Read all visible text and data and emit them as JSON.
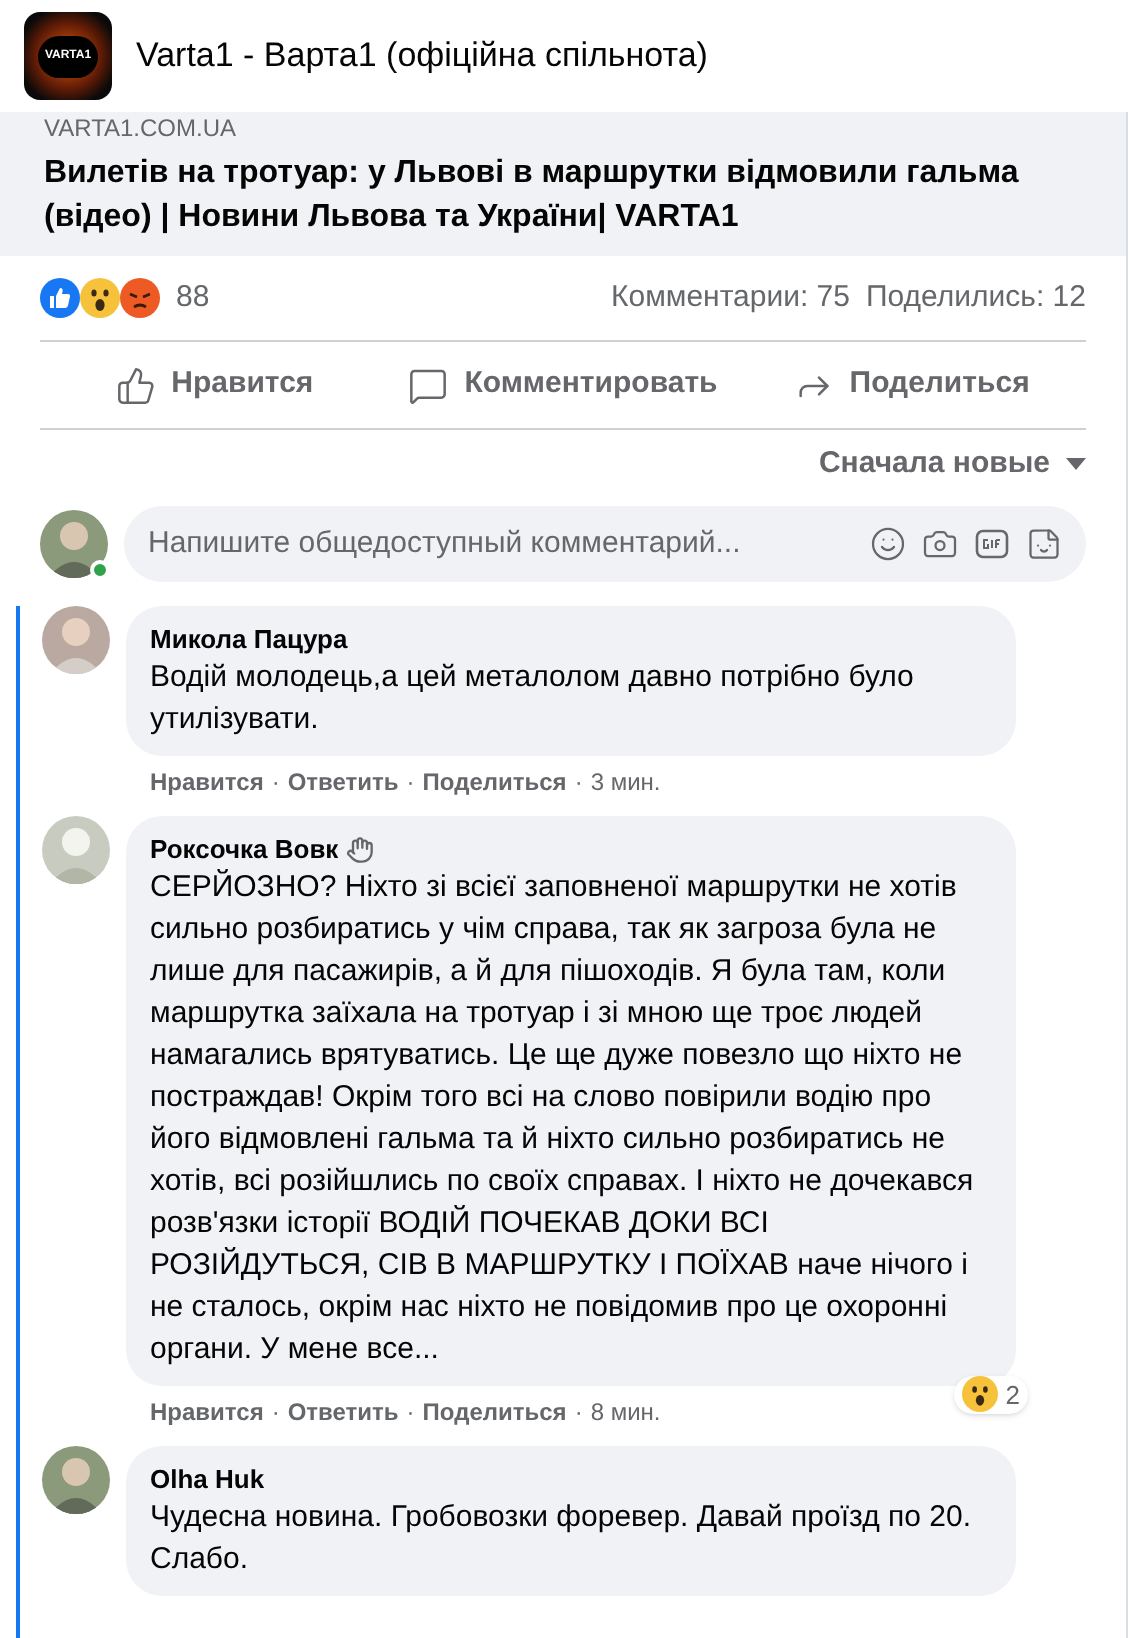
{
  "header": {
    "logo_text": "VARTA1",
    "title": "Varta1 - Варта1 (офіційна спільнота)"
  },
  "link_preview": {
    "domain": "VARTA1.COM.UA",
    "title": "Вилетів на тротуар: у Львові в маршрутки відмовили гальма (відео) | Новини Львова та України| VARTA1"
  },
  "stats": {
    "reactions_count": "88",
    "comments": "Комментарии: 75",
    "shares": "Поделились: 12"
  },
  "actions": [
    {
      "kind": "like",
      "label": "Нравится"
    },
    {
      "kind": "comment",
      "label": "Комментировать"
    },
    {
      "kind": "share",
      "label": "Поделиться"
    }
  ],
  "sort": {
    "label": "Сначала новые"
  },
  "composer": {
    "placeholder": "Напишите общедоступный комментарий...",
    "online": true
  },
  "comments": [
    {
      "author": "Микола Пацура",
      "wave": false,
      "text": "Водій молодець,а цей металолом давно потрібно було утилізувати.",
      "like": "Нравится",
      "reply": "Ответить",
      "share": "Поделиться",
      "separator": "·",
      "time": "3 мин."
    },
    {
      "author": "Роксочка Вовк",
      "wave": true,
      "text": "СЕРЙОЗНО? Ніхто зі всієї заповненої маршрутки не хотів сильно розбиратись у чім справа, так як загроза була не лише для пасажирів, а й для пішоходів. Я була там, коли маршрутка заїхала на тротуар і зі мною ще троє людей намагались врятуватись. Це ще дуже повезло що ніхто не постраждав! Окрім того всі на слово повірили водію про його відмовлені гальма та й ніхто сильно розбиратись не хотів, всі розійшлись по своїх справах. І ніхто не дочекався розв'язки історії ВОДІЙ ПОЧЕКАВ ДОКИ ВСІ РОЗІЙДУТЬСЯ, СІВ В МАРШРУТКУ І ПОЇХАВ наче нічого і не сталось, окрім нас ніхто не повідомив про це охоронні органи. У мене все...",
      "like": "Нравится",
      "reply": "Ответить",
      "share": "Поделиться",
      "separator": "·",
      "time": "8 мин.",
      "reaction_count": "2"
    },
    {
      "author": "Olha Huk",
      "wave": false,
      "text": "Чудесна новина. Гробовозки форевер. Давай проїзд по 20. Слабо."
    }
  ]
}
